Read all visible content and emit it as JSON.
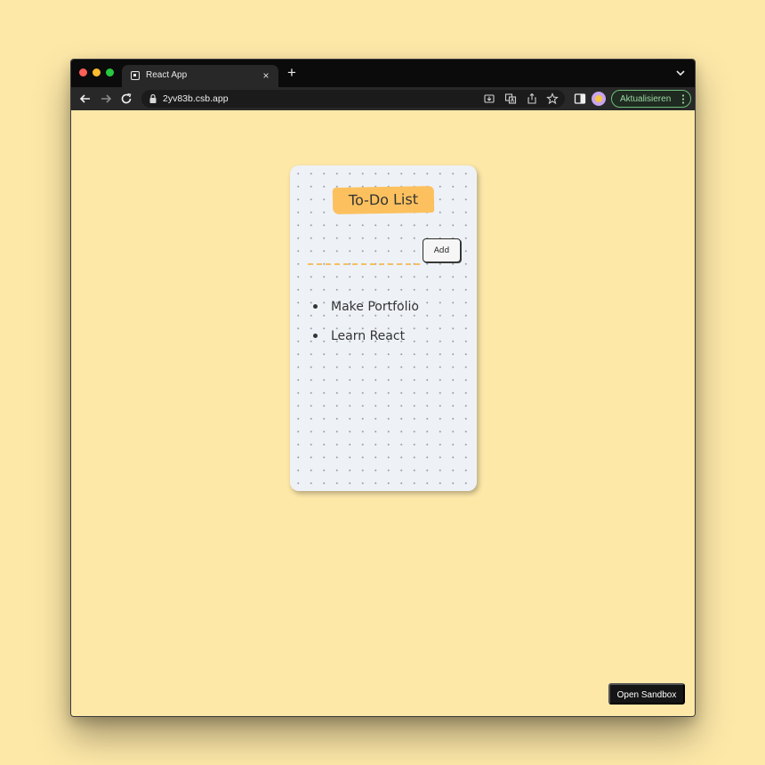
{
  "browser": {
    "tab_title": "React App",
    "tab_close_glyph": "×",
    "new_tab_glyph": "+",
    "url": "2yv83b.csb.app",
    "update_button_label": "Aktualisieren",
    "icons": [
      "back-arrow-icon",
      "forward-arrow-icon",
      "reload-icon",
      "lock-icon",
      "install-icon",
      "translate-icon",
      "share-icon",
      "star-icon",
      "side-panel-icon",
      "profile-avatar",
      "kebab-menu-icon",
      "tab-list-chevron-icon"
    ]
  },
  "app": {
    "title": "To-Do List",
    "input_value": "",
    "add_button_label": "Add",
    "items": [
      {
        "label": "Make Portfolio"
      },
      {
        "label": "Learn React"
      }
    ]
  },
  "sandbox": {
    "open_button_label": "Open Sandbox"
  },
  "colors": {
    "page_background": "#fde8a8",
    "card_background": "#eef2f7",
    "title_highlight": "#fcc15e",
    "input_underline": "#f5c061",
    "update_button_accent": "#6dbf7a"
  }
}
